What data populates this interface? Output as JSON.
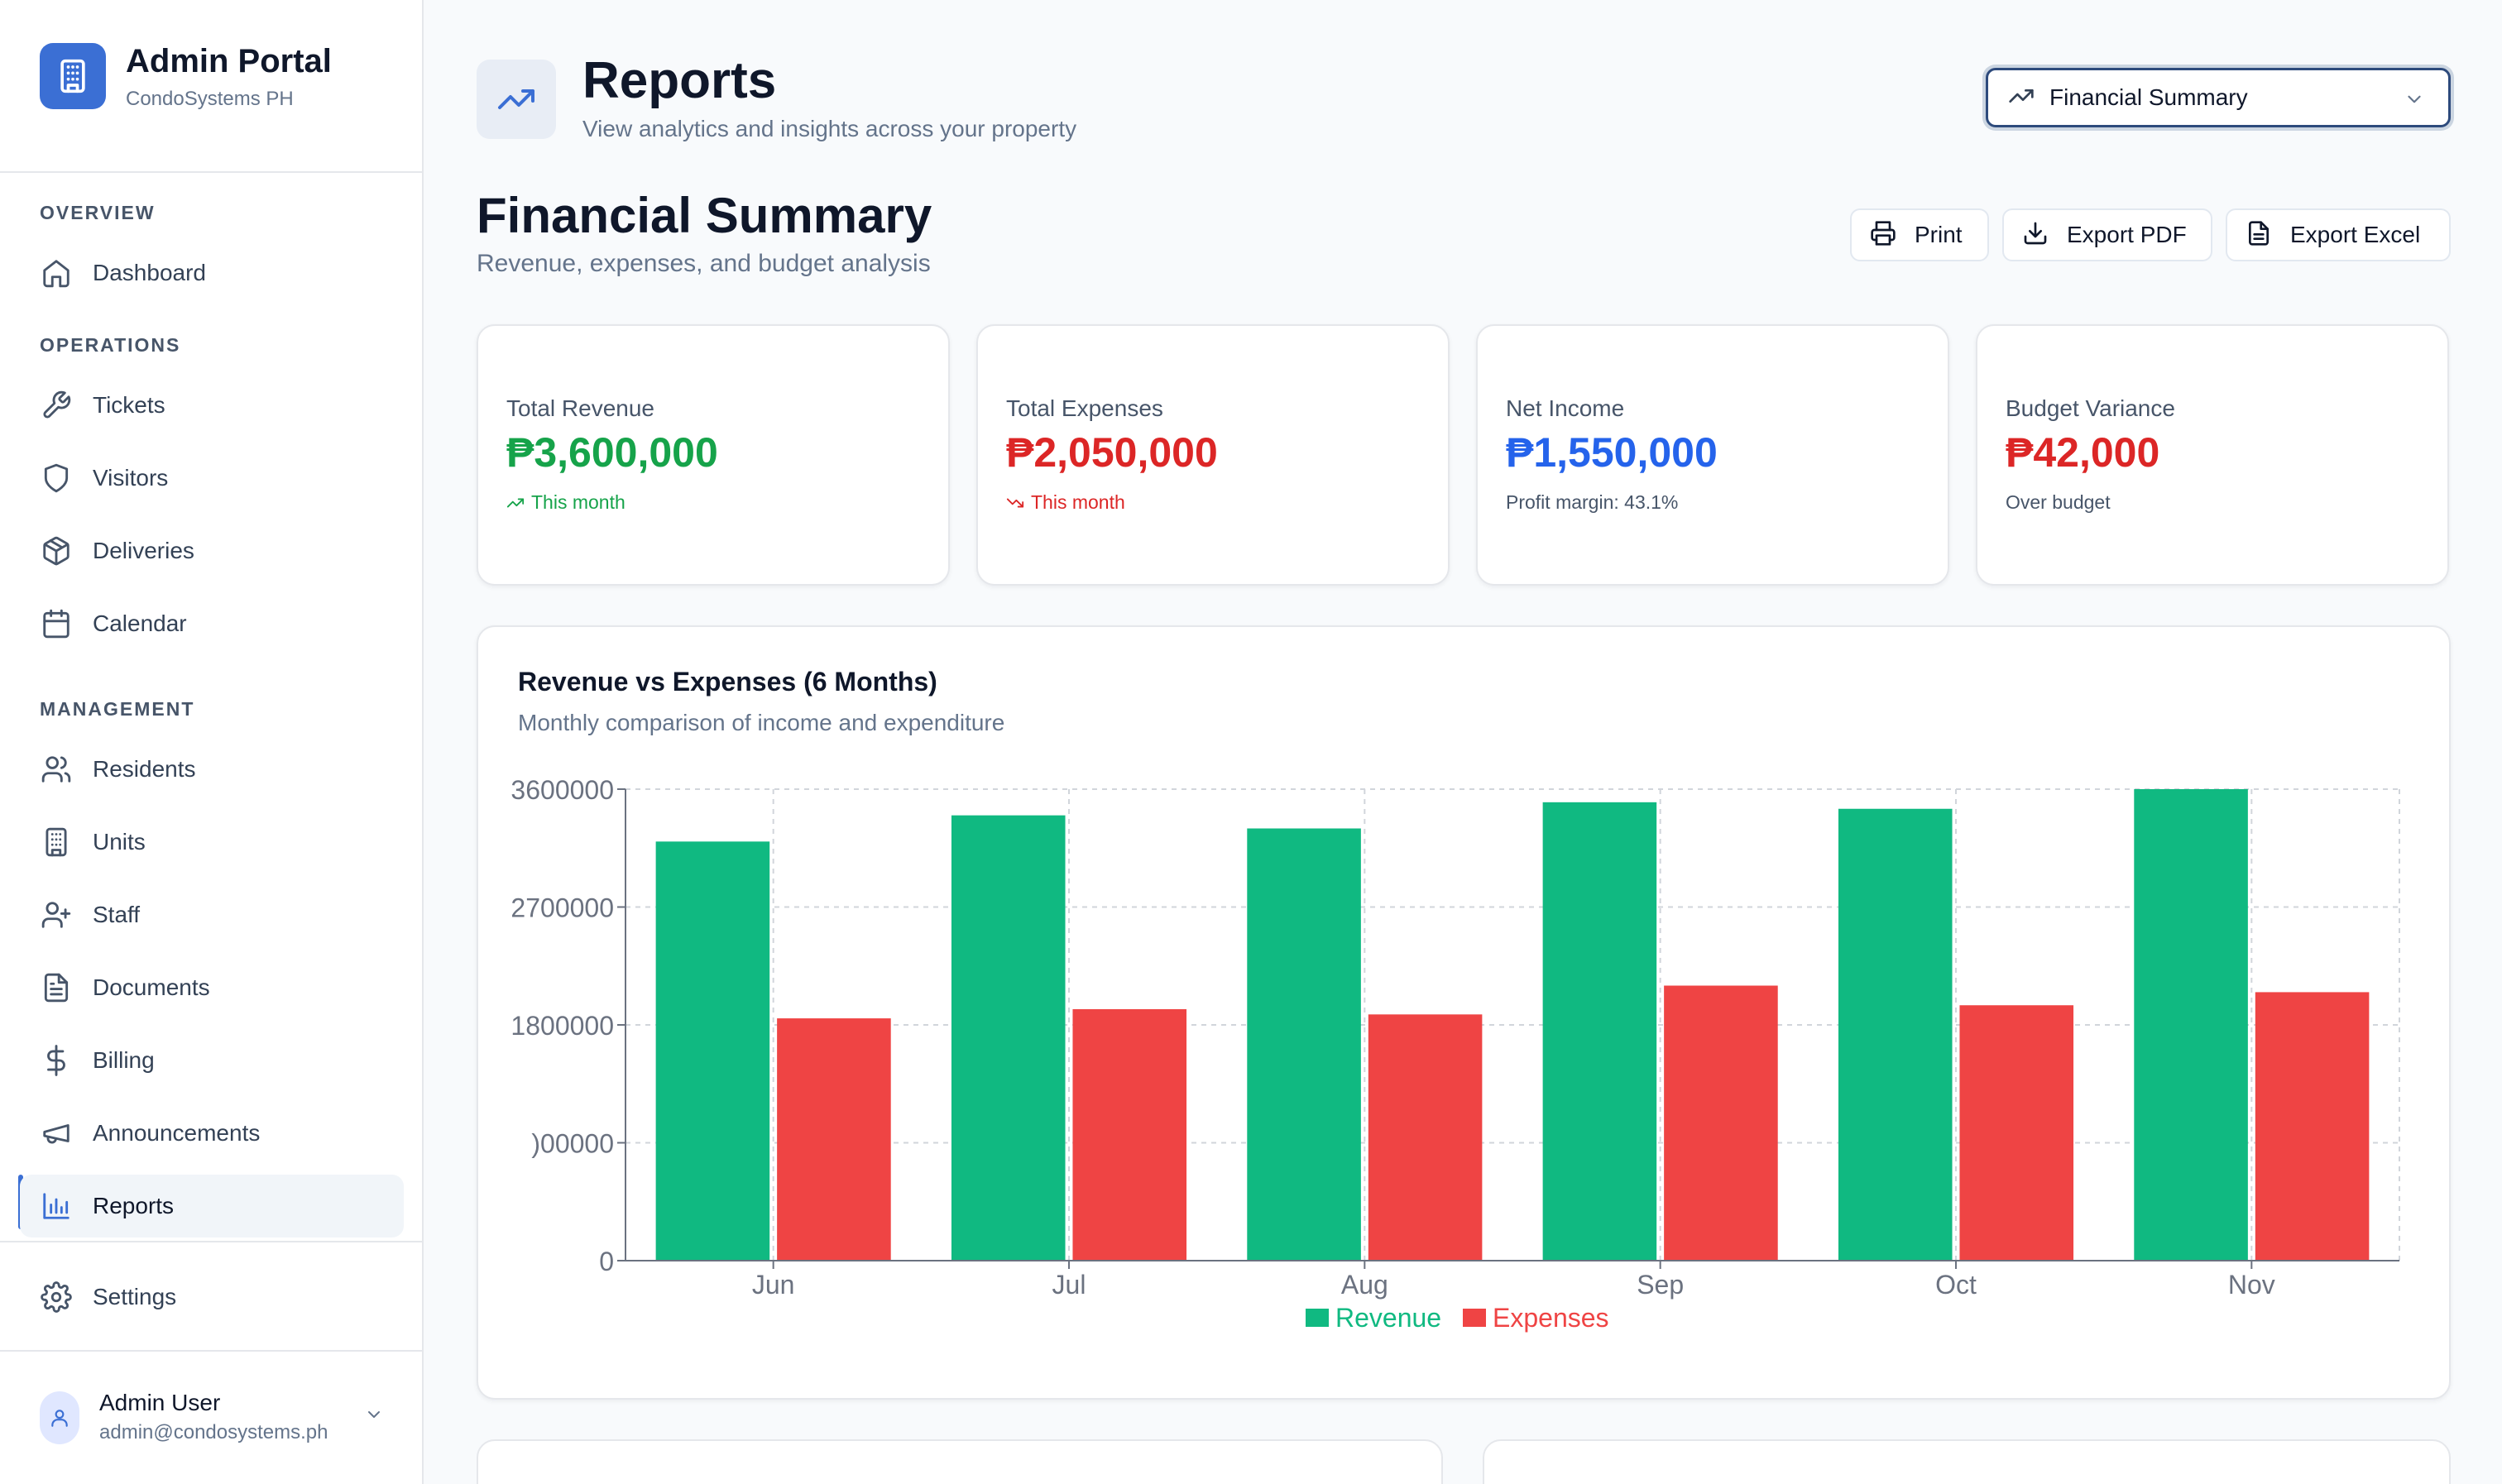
{
  "app": {
    "title": "Admin Portal",
    "subtitle": "CondoSystems PH",
    "logo_icon": "building-icon",
    "accent_color": "#3b6fd4"
  },
  "sidebar": {
    "sections": {
      "overview": "OVERVIEW",
      "operations": "OPERATIONS",
      "management": "MANAGEMENT"
    },
    "items": [
      {
        "label": "Dashboard",
        "icon": "home-icon"
      },
      {
        "label": "Tickets",
        "icon": "wrench-icon"
      },
      {
        "label": "Visitors",
        "icon": "shield-icon"
      },
      {
        "label": "Deliveries",
        "icon": "package-icon"
      },
      {
        "label": "Calendar",
        "icon": "calendar-icon"
      },
      {
        "label": "Residents",
        "icon": "users-icon"
      },
      {
        "label": "Units",
        "icon": "building-icon"
      },
      {
        "label": "Staff",
        "icon": "user-plus-icon"
      },
      {
        "label": "Documents",
        "icon": "document-icon"
      },
      {
        "label": "Billing",
        "icon": "dollar-icon"
      },
      {
        "label": "Announcements",
        "icon": "megaphone-icon"
      },
      {
        "label": "Reports",
        "icon": "bar-chart-icon",
        "active": true
      },
      {
        "label": "Settings",
        "icon": "gear-icon"
      }
    ],
    "user": {
      "name": "Admin User",
      "email": "admin@condosystems.ph"
    }
  },
  "header": {
    "title": "Reports",
    "subtitle": "View analytics and insights across your property",
    "icon": "trending-up-icon",
    "report_select": {
      "value": "Financial Summary"
    }
  },
  "section": {
    "title": "Financial Summary",
    "subtitle": "Revenue, expenses, and budget analysis",
    "buttons": {
      "print": "Print",
      "export_pdf": "Export PDF",
      "export_excel": "Export Excel"
    }
  },
  "kpis": [
    {
      "label": "Total Revenue",
      "value": "₱3,600,000",
      "note": "This month",
      "color": "#16a34a",
      "note_color": "#16a34a",
      "trend": "up"
    },
    {
      "label": "Total Expenses",
      "value": "₱2,050,000",
      "note": "This month",
      "color": "#dc2626",
      "note_color": "#dc2626",
      "trend": "down"
    },
    {
      "label": "Net Income",
      "value": "₱1,550,000",
      "note": "Profit margin: 43.1%",
      "color": "#2563eb",
      "note_color": "#475569",
      "trend": "none"
    },
    {
      "label": "Budget Variance",
      "value": "₱42,000",
      "note": "Over budget",
      "color": "#dc2626",
      "note_color": "#475569",
      "trend": "none"
    }
  ],
  "chart": {
    "title": "Revenue vs Expenses (6 Months)",
    "subtitle": "Monthly comparison of income and expenditure"
  },
  "chart_data": {
    "type": "bar",
    "categories": [
      "Jun",
      "Jul",
      "Aug",
      "Sep",
      "Oct",
      "Nov"
    ],
    "series": [
      {
        "name": "Revenue",
        "color": "#10b981",
        "values": [
          3200000,
          3400000,
          3300000,
          3500000,
          3450000,
          3600000
        ]
      },
      {
        "name": "Expenses",
        "color": "#ef4444",
        "values": [
          1850000,
          1920000,
          1880000,
          2100000,
          1950000,
          2050000
        ]
      }
    ],
    "y_ticks": [
      "0",
      ")00000",
      "1800000",
      "2700000",
      "3600000"
    ],
    "ylim": [
      0,
      3600000
    ],
    "grid": true,
    "legend": "bottom-center"
  }
}
